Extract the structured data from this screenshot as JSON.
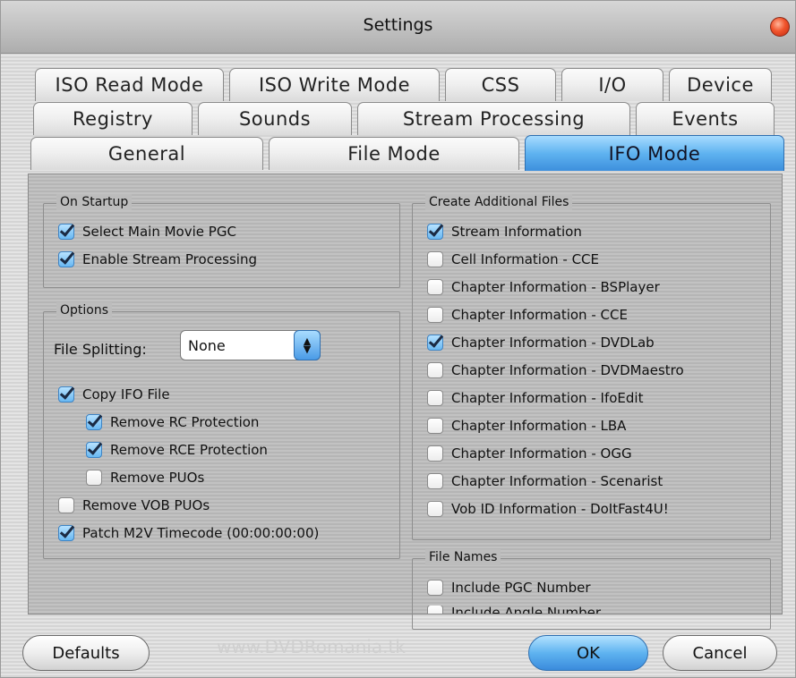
{
  "window": {
    "title": "Settings"
  },
  "tabs": {
    "row1": [
      "ISO Read Mode",
      "ISO Write Mode",
      "CSS",
      "I/O",
      "Device"
    ],
    "row2": [
      "Registry",
      "Sounds",
      "Stream Processing",
      "Events"
    ],
    "row3": [
      "General",
      "File Mode",
      "IFO Mode"
    ],
    "active": "IFO Mode"
  },
  "on_startup": {
    "title": "On Startup",
    "items": [
      {
        "label": "Select Main Movie PGC",
        "checked": true
      },
      {
        "label": "Enable Stream Processing",
        "checked": true
      }
    ]
  },
  "options": {
    "title": "Options",
    "file_splitting_label": "File Splitting:",
    "file_splitting_value": "None",
    "items": [
      {
        "label": "Copy IFO File",
        "checked": true
      },
      {
        "label": "Remove RC Protection",
        "checked": true
      },
      {
        "label": "Remove RCE Protection",
        "checked": true
      },
      {
        "label": "Remove PUOs",
        "checked": false
      },
      {
        "label": "Remove VOB PUOs",
        "checked": false
      },
      {
        "label": "Patch M2V Timecode (00:00:00:00)",
        "checked": true
      }
    ]
  },
  "create_files": {
    "title": "Create Additional Files",
    "items": [
      {
        "label": "Stream Information",
        "checked": true
      },
      {
        "label": "Cell Information - CCE",
        "checked": false
      },
      {
        "label": "Chapter Information - BSPlayer",
        "checked": false
      },
      {
        "label": "Chapter Information - CCE",
        "checked": false
      },
      {
        "label": "Chapter Information - DVDLab",
        "checked": true
      },
      {
        "label": "Chapter Information - DVDMaestro",
        "checked": false
      },
      {
        "label": "Chapter Information - IfoEdit",
        "checked": false
      },
      {
        "label": "Chapter Information - LBA",
        "checked": false
      },
      {
        "label": "Chapter Information - OGG",
        "checked": false
      },
      {
        "label": "Chapter Information - Scenarist",
        "checked": false
      },
      {
        "label": "Vob ID Information - DoItFast4U!",
        "checked": false
      }
    ]
  },
  "file_names": {
    "title": "File Names",
    "items": [
      {
        "label": "Include PGC Number",
        "checked": false
      },
      {
        "label": "Include Angle Number",
        "checked": false
      }
    ]
  },
  "buttons": {
    "defaults": "Defaults",
    "ok": "OK",
    "cancel": "Cancel"
  },
  "watermark": "www.DVDRomania.tk"
}
